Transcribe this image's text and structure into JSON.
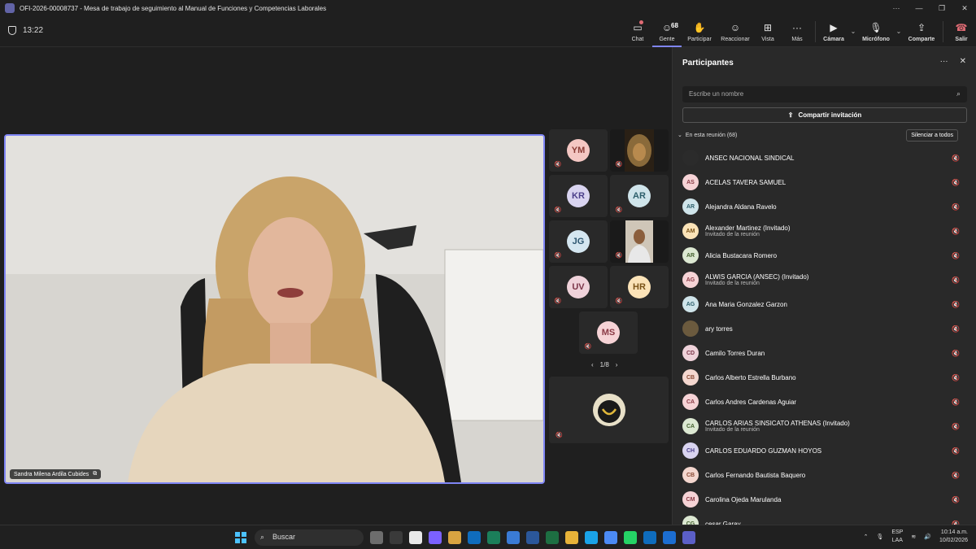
{
  "window": {
    "title": "OFI-2026-00008737 - Mesa de trabajo de seguimiento al Manual de Funciones y Competencias Laborales",
    "controls": [
      "···",
      "—",
      "❐",
      "✕"
    ]
  },
  "toolbar": {
    "timer": "13:22",
    "buttons": [
      {
        "label": "Chat",
        "icon": "chat-icon"
      },
      {
        "label": "Gente",
        "icon": "people-icon",
        "count": "68"
      },
      {
        "label": "Participar",
        "icon": "raise-hand-icon"
      },
      {
        "label": "Reaccionar",
        "icon": "emoji-icon"
      },
      {
        "label": "Vista",
        "icon": "grid-icon"
      },
      {
        "label": "Más",
        "icon": "more-icon"
      },
      {
        "label": "Cámara",
        "icon": "camera-off-icon"
      },
      {
        "label": "Micrófono",
        "icon": "mic-off-icon"
      },
      {
        "label": "Comparte",
        "icon": "share-icon"
      },
      {
        "label": "Salir",
        "icon": "leave-icon"
      }
    ]
  },
  "stage": {
    "speaker_name": "Sandra Milena Ardila Cubides",
    "tiles": [
      {
        "initials": "YM",
        "bg": "#f4c7c3",
        "fg": "#8a3b35"
      },
      {
        "initials": "",
        "photo": "lion"
      },
      {
        "initials": "KR",
        "bg": "#d9d4f0",
        "fg": "#4b3f8a"
      },
      {
        "initials": "AR",
        "bg": "#cfe4ea",
        "fg": "#2d5f6b"
      },
      {
        "initials": "JG",
        "bg": "#d4e6f0",
        "fg": "#2c5670"
      },
      {
        "initials": "",
        "photo": "man"
      },
      {
        "initials": "UV",
        "bg": "#efd2da",
        "fg": "#7b3549"
      },
      {
        "initials": "HR",
        "bg": "#fbe3b8",
        "fg": "#7a5318"
      },
      {
        "initials": "MS",
        "bg": "#f6d3d6",
        "fg": "#8a3a45"
      }
    ],
    "pager": "1/8"
  },
  "panel": {
    "title": "Participantes",
    "search_placeholder": "Escribe un nombre",
    "invite_label": "Compartir invitación",
    "section_label": "En esta reunión (68)",
    "silence_label": "Silenciar a todos",
    "participants": [
      {
        "initials": "",
        "name": "ANSEC NACIONAL SINDICAL",
        "sub": "",
        "bg": "#2b2b2b",
        "fg": "#e0b73a"
      },
      {
        "initials": "AS",
        "name": "ACELAS TAVERA SAMUEL",
        "sub": "",
        "bg": "#f6d3d6",
        "fg": "#8a3a45"
      },
      {
        "initials": "AR",
        "name": "Alejandra Aldana Ravelo",
        "sub": "",
        "bg": "#cfe4ea",
        "fg": "#2d5f6b"
      },
      {
        "initials": "AM",
        "name": "Alexander Martinez (Invitado)",
        "sub": "Invitado de la reunión",
        "bg": "#fbe3b8",
        "fg": "#7a5318"
      },
      {
        "initials": "AR",
        "name": "Alicia Bustacara Romero",
        "sub": "",
        "bg": "#dce8d2",
        "fg": "#44612f"
      },
      {
        "initials": "AG",
        "name": "ALWIS GARCIA (ANSEC) (Invitado)",
        "sub": "Invitado de la reunión",
        "bg": "#f6d3d6",
        "fg": "#8a3a45"
      },
      {
        "initials": "AG",
        "name": "Ana Maria Gonzalez Garzon",
        "sub": "",
        "bg": "#cfe4ea",
        "fg": "#2d5f6b"
      },
      {
        "initials": "",
        "name": "ary torres",
        "sub": "",
        "bg": "#6b5a3e",
        "fg": "#fff"
      },
      {
        "initials": "CD",
        "name": "Camilo Torres Duran",
        "sub": "",
        "bg": "#efd2da",
        "fg": "#7b3549"
      },
      {
        "initials": "CB",
        "name": "Carlos Alberto Estrella Burbano",
        "sub": "",
        "bg": "#f4d7cf",
        "fg": "#8a4a35"
      },
      {
        "initials": "CA",
        "name": "Carlos Andres Cardenas Aguiar",
        "sub": "",
        "bg": "#f6d3d6",
        "fg": "#8a3a45"
      },
      {
        "initials": "CA",
        "name": "CARLOS ARIAS SINSICATO ATHENAS (Invitado)",
        "sub": "Invitado de la reunión",
        "bg": "#dce8d2",
        "fg": "#44612f"
      },
      {
        "initials": "CH",
        "name": "CARLOS EDUARDO GUZMAN HOYOS",
        "sub": "",
        "bg": "#d9d4f0",
        "fg": "#4b3f8a"
      },
      {
        "initials": "CB",
        "name": "Carlos Fernando Bautista Baquero",
        "sub": "",
        "bg": "#f4d7cf",
        "fg": "#8a4a35"
      },
      {
        "initials": "CM",
        "name": "Carolina Ojeda Marulanda",
        "sub": "",
        "bg": "#f6d3d6",
        "fg": "#8a3a45"
      },
      {
        "initials": "CG",
        "name": "cesar Garay",
        "sub": "",
        "bg": "#dce8d2",
        "fg": "#44612f"
      }
    ]
  },
  "taskbar": {
    "search_label": "Buscar",
    "lang_top": "ESP",
    "lang_bottom": "LAA",
    "time": "10:14 a.m.",
    "date": "10/02/2026",
    "apps": [
      "#6d6d6d",
      "#3a3a3a",
      "#e8e8e8",
      "#7b61ff",
      "#d9a441",
      "#0f6cbd",
      "#1b7f5a",
      "#3a7bd5",
      "#2b579a",
      "#1d6f42",
      "#e8b339",
      "#1aa3e8",
      "#4c8bf5",
      "#25d366",
      "#0f6cbd",
      "#1c6dd0",
      "#5b5fc7"
    ]
  }
}
